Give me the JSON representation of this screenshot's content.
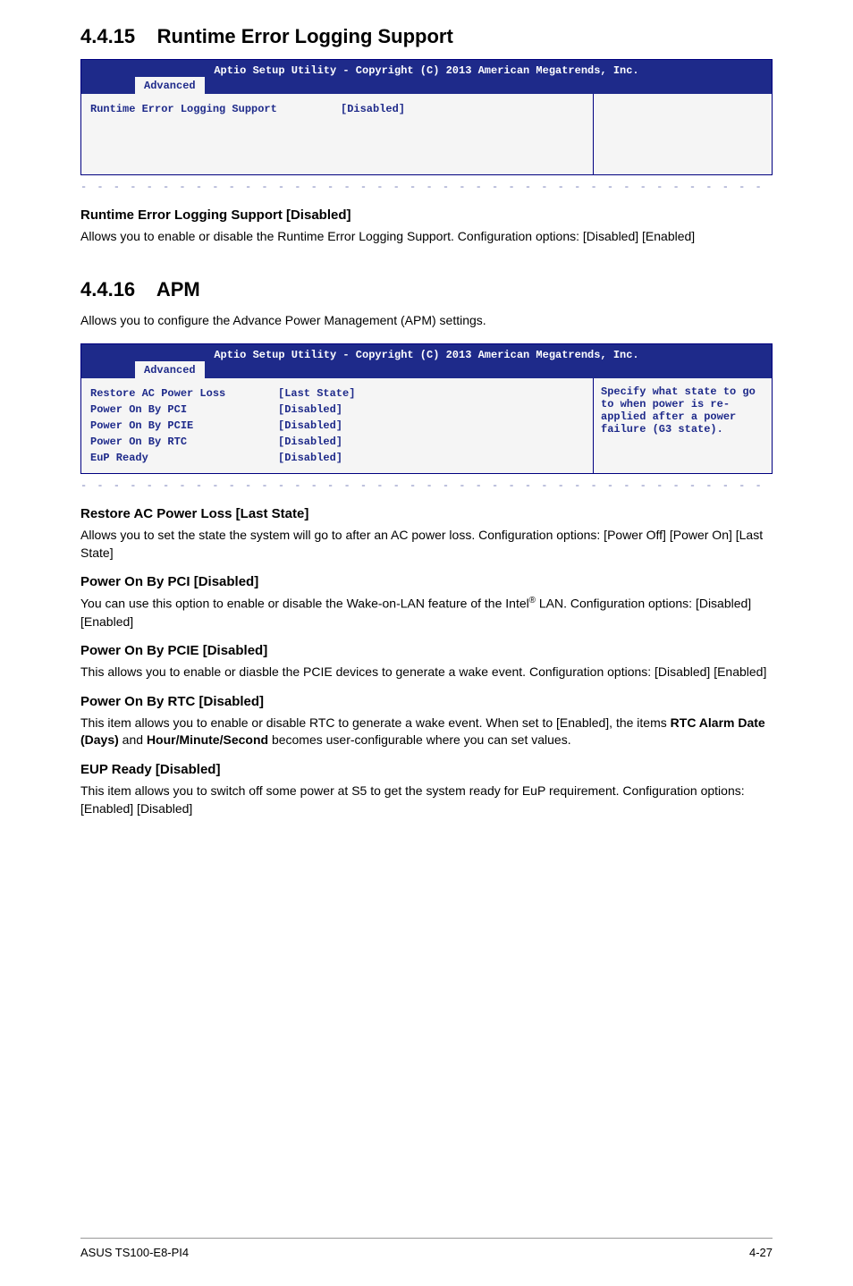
{
  "section1": {
    "number": "4.4.15",
    "title": "Runtime Error Logging Support",
    "bios": {
      "header": "Aptio Setup Utility - Copyright (C) 2013 American Megatrends, Inc.",
      "tab": "Advanced",
      "rows": [
        {
          "label": "Runtime Error Logging Support",
          "value": "[Disabled]"
        }
      ],
      "help": ""
    },
    "subs": [
      {
        "heading": "Runtime Error Logging Support [Disabled]",
        "para": "Allows you to enable or disable the Runtime Error Logging Support. Configuration options: [Disabled] [Enabled]"
      }
    ]
  },
  "section2": {
    "number": "4.4.16",
    "title": "APM",
    "intro": "Allows you to configure the Advance Power Management (APM) settings.",
    "bios": {
      "header": "Aptio Setup Utility - Copyright (C) 2013 American Megatrends, Inc.",
      "tab": "Advanced",
      "rows": [
        {
          "label": "Restore AC Power Loss",
          "value": "[Last State]"
        },
        {
          "label": "Power On By PCI",
          "value": "[Disabled]"
        },
        {
          "label": "Power On By PCIE",
          "value": "[Disabled]"
        },
        {
          "label": "Power On By RTC",
          "value": "[Disabled]"
        },
        {
          "label": "EuP Ready",
          "value": "[Disabled]"
        }
      ],
      "help": "Specify what state to go to when power is re-applied after a power failure (G3 state)."
    },
    "subs": [
      {
        "heading": "Restore AC Power Loss [Last State]",
        "para": "Allows you to set the state the system will go to after an AC power loss. Configuration options: [Power Off] [Power On] [Last State]"
      },
      {
        "heading": "Power On By PCI [Disabled]",
        "para_html": "You can use this option to enable or disable the Wake-on-LAN feature of the Intel<sup>®</sup> LAN. Configuration options: [Disabled] [Enabled]"
      },
      {
        "heading": "Power On By PCIE [Disabled]",
        "para": "This allows you to enable or diasble the PCIE devices to generate a wake event. Configuration options: [Disabled] [Enabled]"
      },
      {
        "heading": "Power On By RTC [Disabled]",
        "para_html": "This item allows you to enable or disable RTC to generate a wake event. When set to [Enabled], the items <b>RTC Alarm Date (Days)</b> and <b>Hour/Minute/Second</b> becomes user-configurable where you can set values."
      },
      {
        "heading": "EUP Ready [Disabled]",
        "para": "This item allows you to switch off some power at S5 to get the system ready for EuP requirement. Configuration options: [Enabled] [Disabled]"
      }
    ]
  },
  "footer": {
    "left": "ASUS TS100-E8-PI4",
    "right": "4-27"
  },
  "dashes": "- - - - - - - - - - - - - - - - - - - - - - - - - - - - - - - - - - - - - - - - - - - - - - - - - - - - -"
}
